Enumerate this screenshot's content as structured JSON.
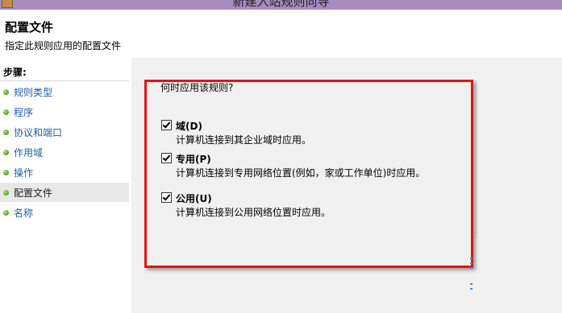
{
  "window": {
    "title": "新建入站规则向导"
  },
  "header": {
    "title": "配置文件",
    "subtitle": "指定此规则应用的配置文件"
  },
  "sidebar": {
    "steps_title": "步骤:",
    "items": [
      {
        "label": "规则类型"
      },
      {
        "label": "程序"
      },
      {
        "label": "协议和端口"
      },
      {
        "label": "作用域"
      },
      {
        "label": "操作"
      },
      {
        "label": "配置文件",
        "active": true
      },
      {
        "label": "名称"
      }
    ]
  },
  "main": {
    "question": "何时应用该规则?",
    "options": [
      {
        "label": "域(D)",
        "description": "计算机连接到其企业域时应用。",
        "checked": true
      },
      {
        "label": "专用(P)",
        "description": "计算机连接到专用网络位置(例如，家或工作单位)时应用。",
        "checked": true
      },
      {
        "label": "公用(U)",
        "description": "计算机连接到公用网络位置时应用。",
        "checked": true
      }
    ]
  },
  "colors": {
    "title_bar": "#a78cc0",
    "link": "#1f5f9e",
    "step_bullet": "#5db12a",
    "highlight": "#e01515",
    "panel_bg": "#f0f0f0"
  }
}
